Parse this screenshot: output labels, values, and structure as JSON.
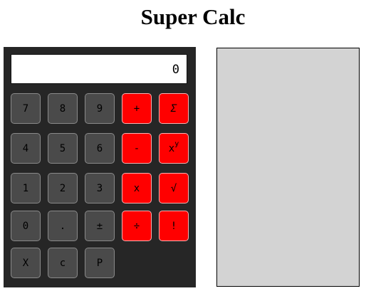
{
  "title": "Super Calc",
  "display": {
    "value": "0"
  },
  "keys": {
    "k7": "7",
    "k8": "8",
    "k9": "9",
    "plus": "+",
    "sigma": "Σ",
    "k4": "4",
    "k5": "5",
    "k6": "6",
    "minus": "-",
    "power_base": "x",
    "power_exp": "y",
    "k1": "1",
    "k2": "2",
    "k3": "3",
    "times": "x",
    "sqrt": "√",
    "k0": "0",
    "dot": ".",
    "plusminus": "±",
    "divide": "÷",
    "factorial": "!",
    "x": "X",
    "clear": "c",
    "p": "P"
  },
  "colors": {
    "body_bg": "#262626",
    "key_bg": "#4a4a4a",
    "operator_bg": "#ff0000",
    "panel_bg": "#d3d3d3"
  }
}
